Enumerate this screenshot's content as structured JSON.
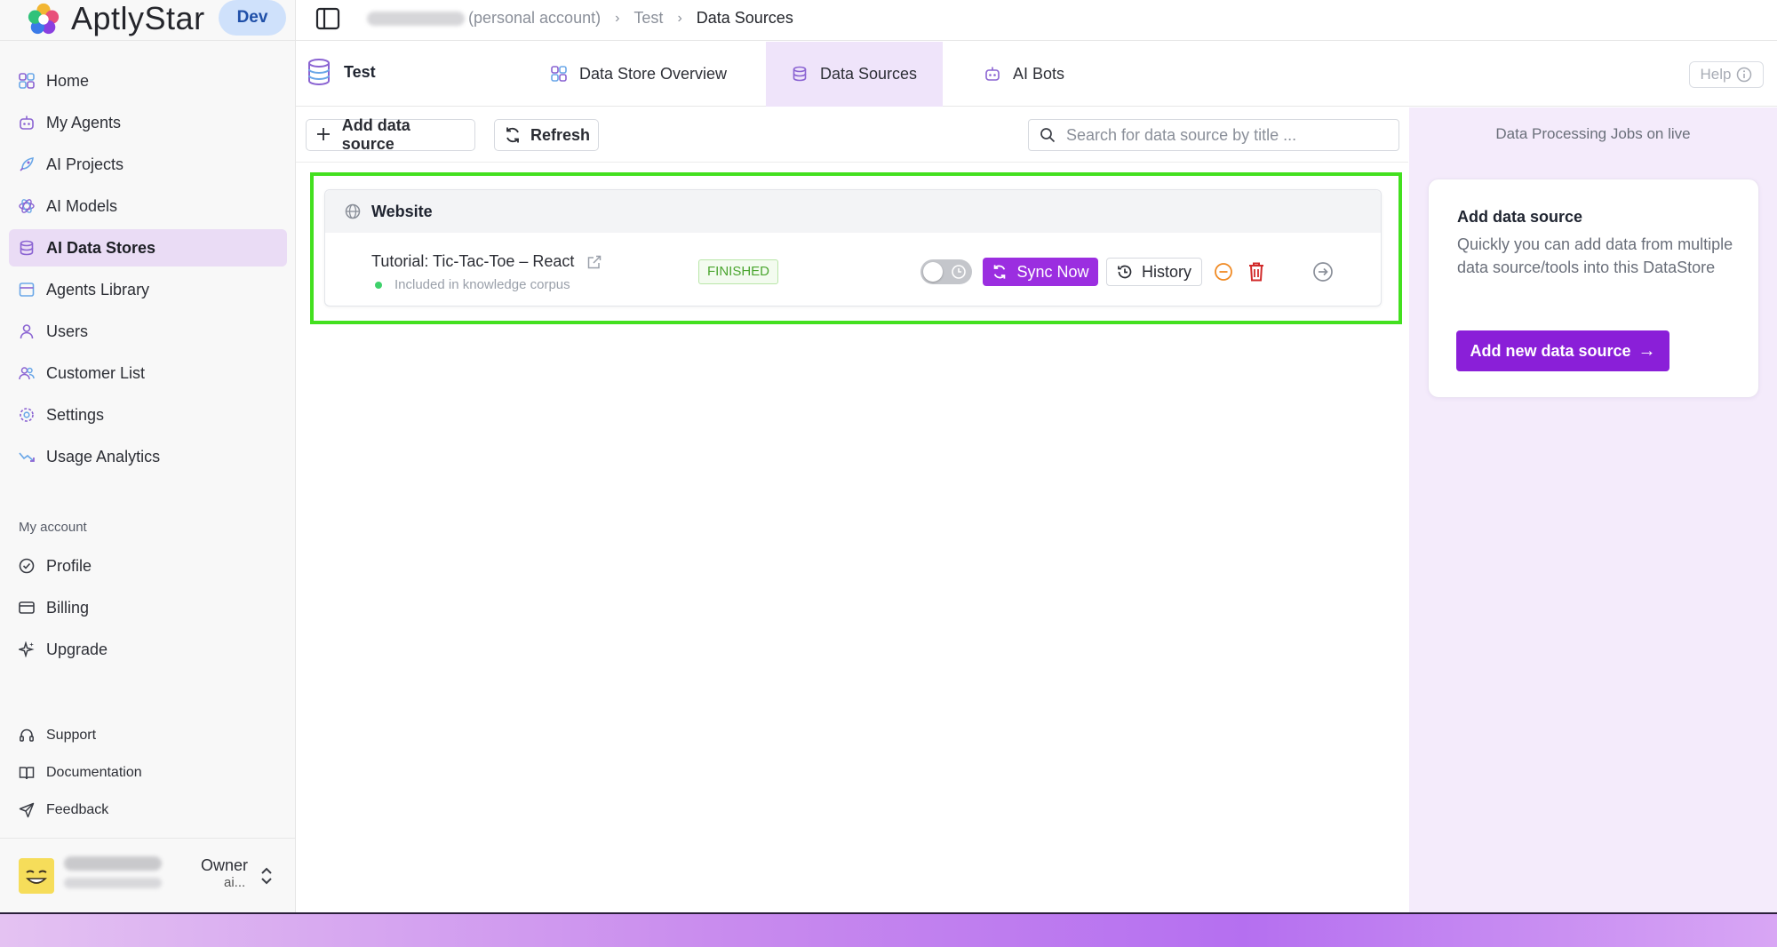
{
  "brand": {
    "name": "AptlyStar",
    "env_badge": "Dev"
  },
  "sidebar": {
    "items": [
      {
        "label": "Home",
        "icon": "grid-icon"
      },
      {
        "label": "My Agents",
        "icon": "robot-icon"
      },
      {
        "label": "AI Projects",
        "icon": "rocket-icon"
      },
      {
        "label": "AI Models",
        "icon": "atom-icon"
      },
      {
        "label": "AI Data Stores",
        "icon": "database-icon",
        "active": true
      },
      {
        "label": "Agents Library",
        "icon": "library-icon"
      },
      {
        "label": "Users",
        "icon": "user-icon"
      },
      {
        "label": "Customer List",
        "icon": "users-icon"
      },
      {
        "label": "Settings",
        "icon": "gear-icon"
      },
      {
        "label": "Usage Analytics",
        "icon": "trend-icon"
      }
    ],
    "account_title": "My account",
    "account_items": [
      {
        "label": "Profile",
        "icon": "check-circle-icon"
      },
      {
        "label": "Billing",
        "icon": "card-icon"
      },
      {
        "label": "Upgrade",
        "icon": "sparkle-icon"
      }
    ],
    "support_items": [
      {
        "label": "Support",
        "icon": "headset-icon"
      },
      {
        "label": "Documentation",
        "icon": "book-icon"
      },
      {
        "label": "Feedback",
        "icon": "send-icon"
      }
    ],
    "user": {
      "role": "Owner",
      "email_tail": "ai..."
    }
  },
  "topbar": {
    "breadcrumbs": [
      "(personal account)",
      "Test",
      "Data Sources"
    ]
  },
  "store": {
    "title": "Test",
    "tabs": [
      {
        "label": "Data Store Overview",
        "icon": "grid-icon"
      },
      {
        "label": "Data Sources",
        "icon": "database-icon",
        "active": true
      },
      {
        "label": "AI Bots",
        "icon": "robot-icon"
      }
    ],
    "help_label": "Help"
  },
  "toolbar": {
    "add_label": "Add data source",
    "refresh_label": "Refresh",
    "search_placeholder": "Search for data source by title ..."
  },
  "groups": [
    {
      "name": "Website",
      "icon": "globe-icon",
      "rows": [
        {
          "title": "Tutorial: Tic-Tac-Toe – React",
          "subtitle": "Included in knowledge corpus",
          "status": "FINISHED",
          "sync_label": "Sync Now",
          "history_label": "History",
          "toggle_on": false
        }
      ]
    }
  ],
  "right_panel": {
    "title": "Data Processing Jobs on live",
    "card_title": "Add data source",
    "card_desc": "Quickly you can add data from multiple data source/tools into this DataStore",
    "card_button": "Add new data source"
  },
  "colors": {
    "accent": "#9b2ee0",
    "accent_dark": "#8a1fd8",
    "active_nav": "#eadcf5",
    "highlight": "#43e01f",
    "status_green": "#4aa52e",
    "delete_red": "#d12a2a",
    "remove_orange": "#f08a24"
  }
}
